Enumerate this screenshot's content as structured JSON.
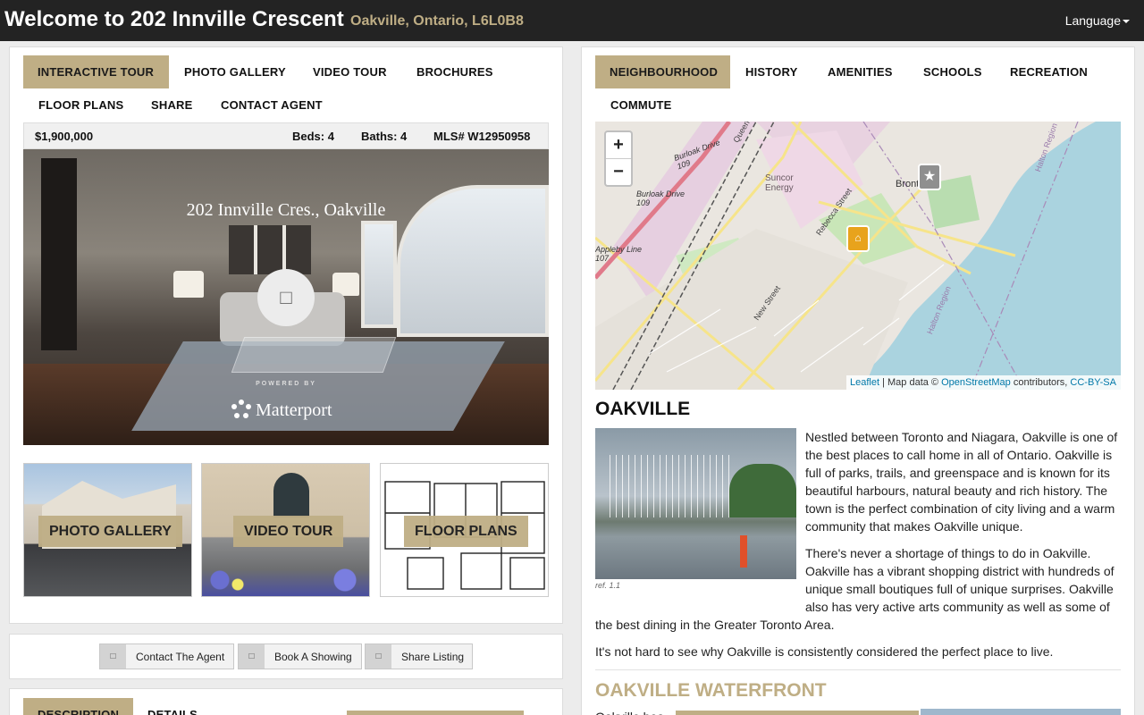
{
  "header": {
    "title": "Welcome to 202 Innville Crescent",
    "subtitle": "Oakville, Ontario, L6L0B8",
    "language_label": "Language"
  },
  "left_tabs": [
    "Interactive Tour",
    "Photo Gallery",
    "Video Tour",
    "Brochures",
    "Floor Plans",
    "Share",
    "Contact Agent"
  ],
  "listing": {
    "price": "$1,900,000",
    "beds": "Beds: 4",
    "baths": "Baths: 4",
    "mls": "MLS# W12950958"
  },
  "tour": {
    "caption": "202 Innville Cres., Oakville",
    "powered_by": "POWERED BY",
    "brand": "Matterport",
    "play_icon": "play-icon"
  },
  "thumbs": {
    "photo_gallery": "Photo Gallery",
    "video_tour": "Video Tour",
    "floor_plans": "Floor Plans"
  },
  "actions": {
    "contact": "Contact The Agent",
    "showing": "Book A Showing",
    "share": "Share Listing"
  },
  "bottom_tabs": [
    "Description",
    "Details"
  ],
  "right_tabs": [
    "Neighbourhood",
    "History",
    "Amenities",
    "Schools",
    "Recreation",
    "Commute"
  ],
  "map": {
    "zoom_in": "+",
    "zoom_out": "−",
    "labels": [
      "Burloak Drive 109",
      "Burloak Drive 109",
      "Appleby Line 107",
      "Suncor Energy",
      "Rebecca Street",
      "New Street",
      "Bronte",
      "Halton Region",
      "Halton Region",
      "Queen"
    ],
    "attribution": {
      "leaflet": "Leaflet",
      "mid": "| Map data ©",
      "osm": "OpenStreetMap",
      "contrib": "contributors,",
      "license": "CC-BY-SA"
    }
  },
  "neighbourhood": {
    "city_heading": "OAKVILLE",
    "photo_ref": "ref. 1.1",
    "para1": "Nestled between Toronto and Niagara, Oakville is one of the best places to call home in all of Ontario. Oakville is full of parks, trails, and greenspace and is known for its beautiful harbours, natural beauty and rich history. The town is the perfect combination of city living and a warm community that makes Oakville unique.",
    "para2a": "There's never a shortage of things to do in Oakville. Oakville has a vibrant shopping district with hundreds of unique small boutiques full of unique surprises. Oakville also has very active arts community as well as some of",
    "para2b": "the best dining in the Greater Toronto Area.",
    "para3": "It's not hard to see why Oakville is consistently considered the perfect place to live.",
    "waterfront_heading": "OAKVILLE WATERFRONT",
    "waterfront_text": "Oakville boa"
  },
  "colors": {
    "accent": "#bfae85",
    "topbar": "#232323",
    "lake": "#aad3df"
  }
}
